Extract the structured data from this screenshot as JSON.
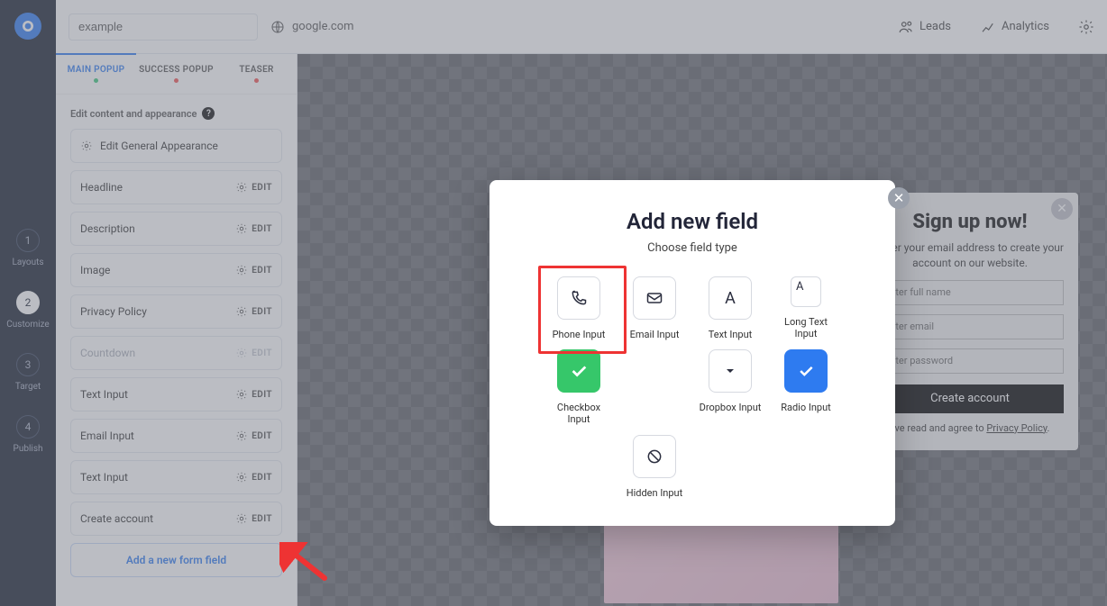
{
  "top": {
    "project_name": "example",
    "domain": "google.com",
    "nav_leads": "Leads",
    "nav_analytics": "Analytics"
  },
  "steps": [
    {
      "num": "1",
      "label": "Layouts"
    },
    {
      "num": "2",
      "label": "Customize"
    },
    {
      "num": "3",
      "label": "Target"
    },
    {
      "num": "4",
      "label": "Publish"
    }
  ],
  "tabs": {
    "main": "MAIN POPUP",
    "success": "SUCCESS POPUP",
    "teaser": "TEASER"
  },
  "section_title": "Edit content and appearance",
  "edit_label": "EDIT",
  "rows": {
    "general": "Edit General Appearance",
    "headline": "Headline",
    "description": "Description",
    "image": "Image",
    "privacy": "Privacy Policy",
    "countdown": "Countdown",
    "text1": "Text Input",
    "email": "Email Input",
    "text2": "Text Input",
    "create": "Create account",
    "add_new": "Add a new form field"
  },
  "modal": {
    "title": "Add new field",
    "subtitle": "Choose field type",
    "options": {
      "phone": "Phone Input",
      "email": "Email Input",
      "text": "Text Input",
      "long": "Long Text Input",
      "checkbox": "Checkbox Input",
      "dropbox": "Dropbox Input",
      "radio": "Radio Input",
      "hidden": "Hidden Input"
    }
  },
  "preview": {
    "title": "Sign up now!",
    "body": "Enter your email address to create your account on our website.",
    "f1": "Enter full name",
    "f2": "Enter email",
    "f3": "Enter password",
    "cta": "Create account",
    "pp_pre": "I've read and agree to ",
    "pp_link": "Privacy Policy"
  }
}
